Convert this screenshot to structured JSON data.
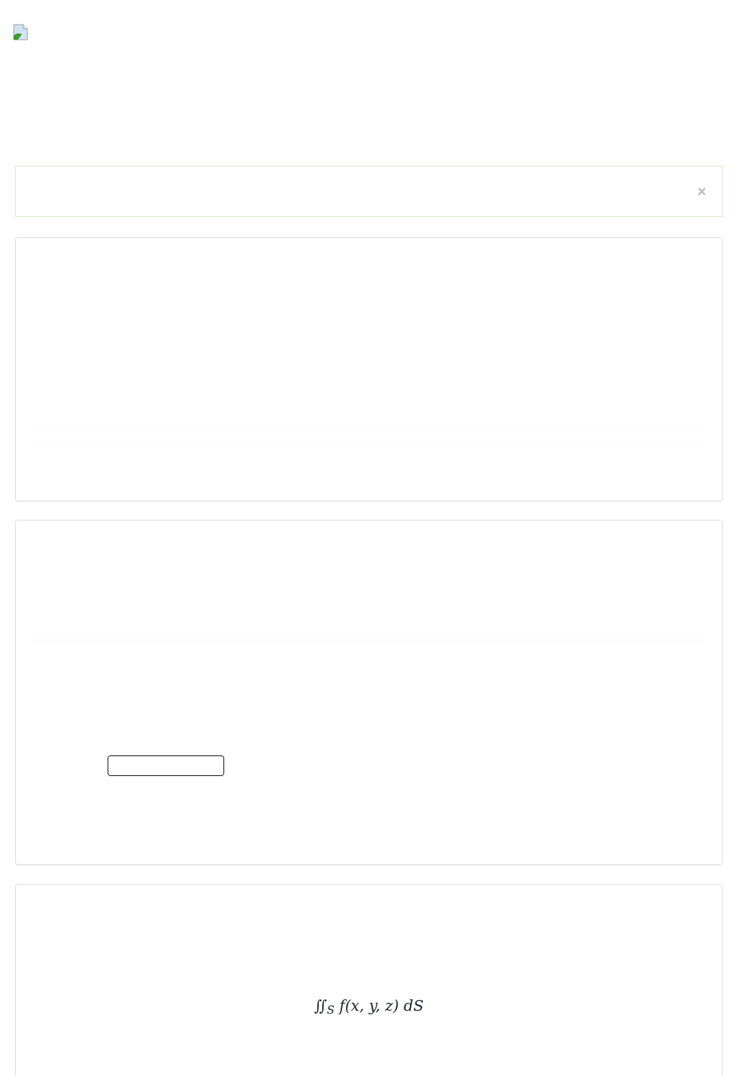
{
  "alert": {
    "close_symbol": "×"
  },
  "formula": "∬$_{S}$ f(x, y, z) dS"
}
